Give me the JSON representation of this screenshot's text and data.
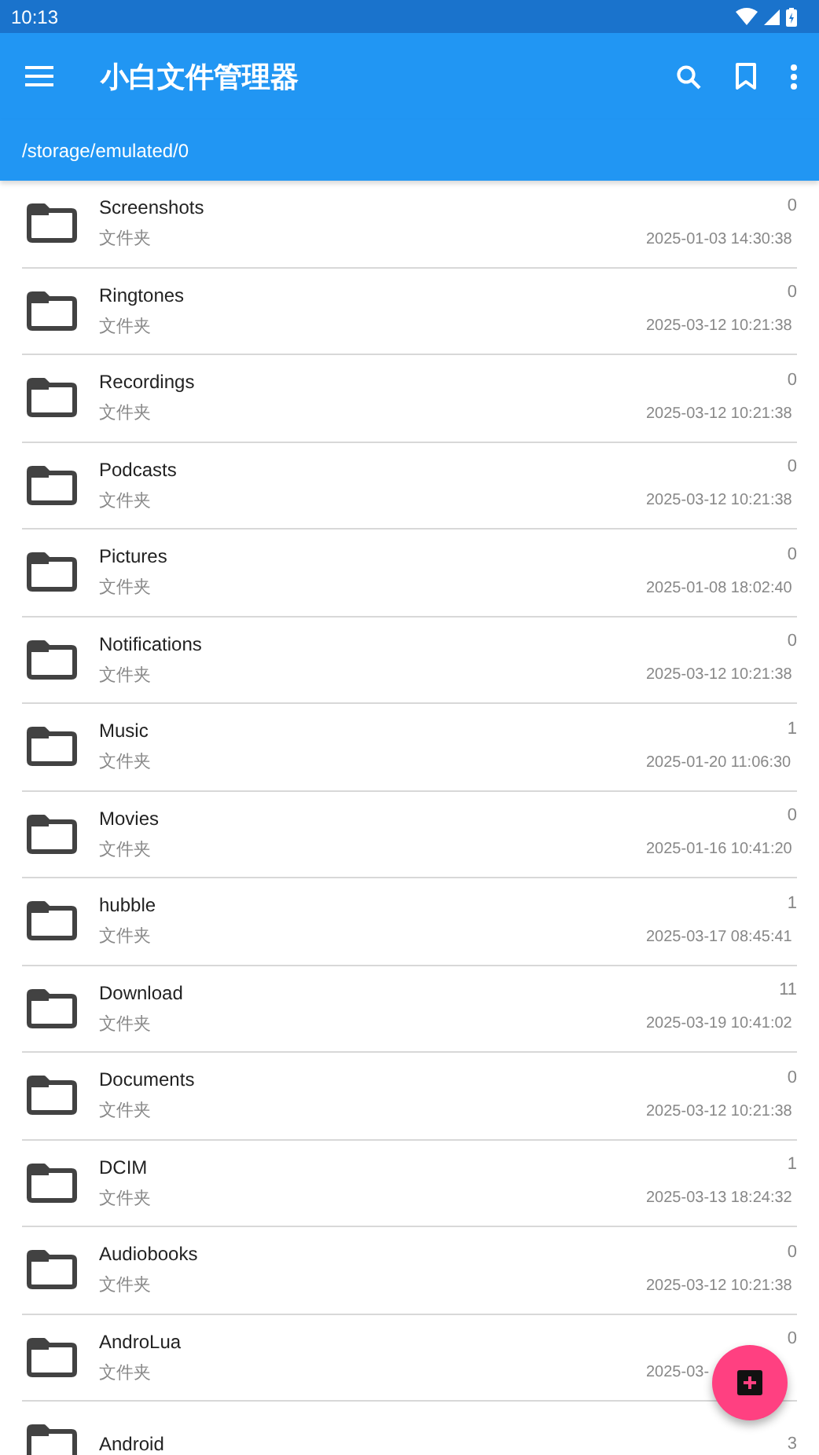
{
  "status_bar": {
    "time": "10:13"
  },
  "app_bar": {
    "title": "小白文件管理器"
  },
  "path": "/storage/emulated/0",
  "files": [
    {
      "name": "Screenshots",
      "type": "文件夹",
      "count": "0",
      "date": "2025-01-03 14:30:38"
    },
    {
      "name": "Ringtones",
      "type": "文件夹",
      "count": "0",
      "date": "2025-03-12 10:21:38"
    },
    {
      "name": "Recordings",
      "type": "文件夹",
      "count": "0",
      "date": "2025-03-12 10:21:38"
    },
    {
      "name": "Podcasts",
      "type": "文件夹",
      "count": "0",
      "date": "2025-03-12 10:21:38"
    },
    {
      "name": "Pictures",
      "type": "文件夹",
      "count": "0",
      "date": "2025-01-08 18:02:40"
    },
    {
      "name": "Notifications",
      "type": "文件夹",
      "count": "0",
      "date": "2025-03-12 10:21:38"
    },
    {
      "name": "Music",
      "type": "文件夹",
      "count": "1",
      "date": "2025-01-20 11:06:30"
    },
    {
      "name": "Movies",
      "type": "文件夹",
      "count": "0",
      "date": "2025-01-16 10:41:20"
    },
    {
      "name": "hubble",
      "type": "文件夹",
      "count": "1",
      "date": "2025-03-17 08:45:41"
    },
    {
      "name": "Download",
      "type": "文件夹",
      "count": "11",
      "date": "2025-03-19 10:41:02"
    },
    {
      "name": "Documents",
      "type": "文件夹",
      "count": "0",
      "date": "2025-03-12 10:21:38"
    },
    {
      "name": "DCIM",
      "type": "文件夹",
      "count": "1",
      "date": "2025-03-13 18:24:32"
    },
    {
      "name": "Audiobooks",
      "type": "文件夹",
      "count": "0",
      "date": "2025-03-12 10:21:38"
    },
    {
      "name": "AndroLua",
      "type": "文件夹",
      "count": "0",
      "date": "2025-03-"
    },
    {
      "name": "Android",
      "count": "3"
    }
  ]
}
